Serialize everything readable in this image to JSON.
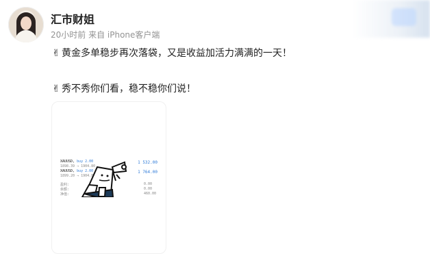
{
  "post": {
    "username": "汇市财姐",
    "meta": "20小时前 来自 iPhone客户端",
    "line1_emoji": "✌",
    "line1_text": "黄金多单稳步再次落袋，又是收益加活力满满的一天！",
    "line2_emoji": "✌",
    "line2_text": "秀不秀你们看，稳不稳你们说！"
  },
  "trade_card": {
    "rows": [
      {
        "symbol": "XAUUSD,",
        "side": "buy 2.00",
        "prices": "1898.39 → 1904.80",
        "profit": "1 532.00"
      },
      {
        "symbol": "XAUUSD,",
        "side": "buy 2.00",
        "prices": "1899.20 → 1904.80",
        "profit": "1 764.00"
      }
    ],
    "footer_left": [
      "盈利:",
      "余额:",
      "净值:"
    ],
    "footer_right": [
      "0.00",
      "0.00",
      "460.00"
    ]
  }
}
